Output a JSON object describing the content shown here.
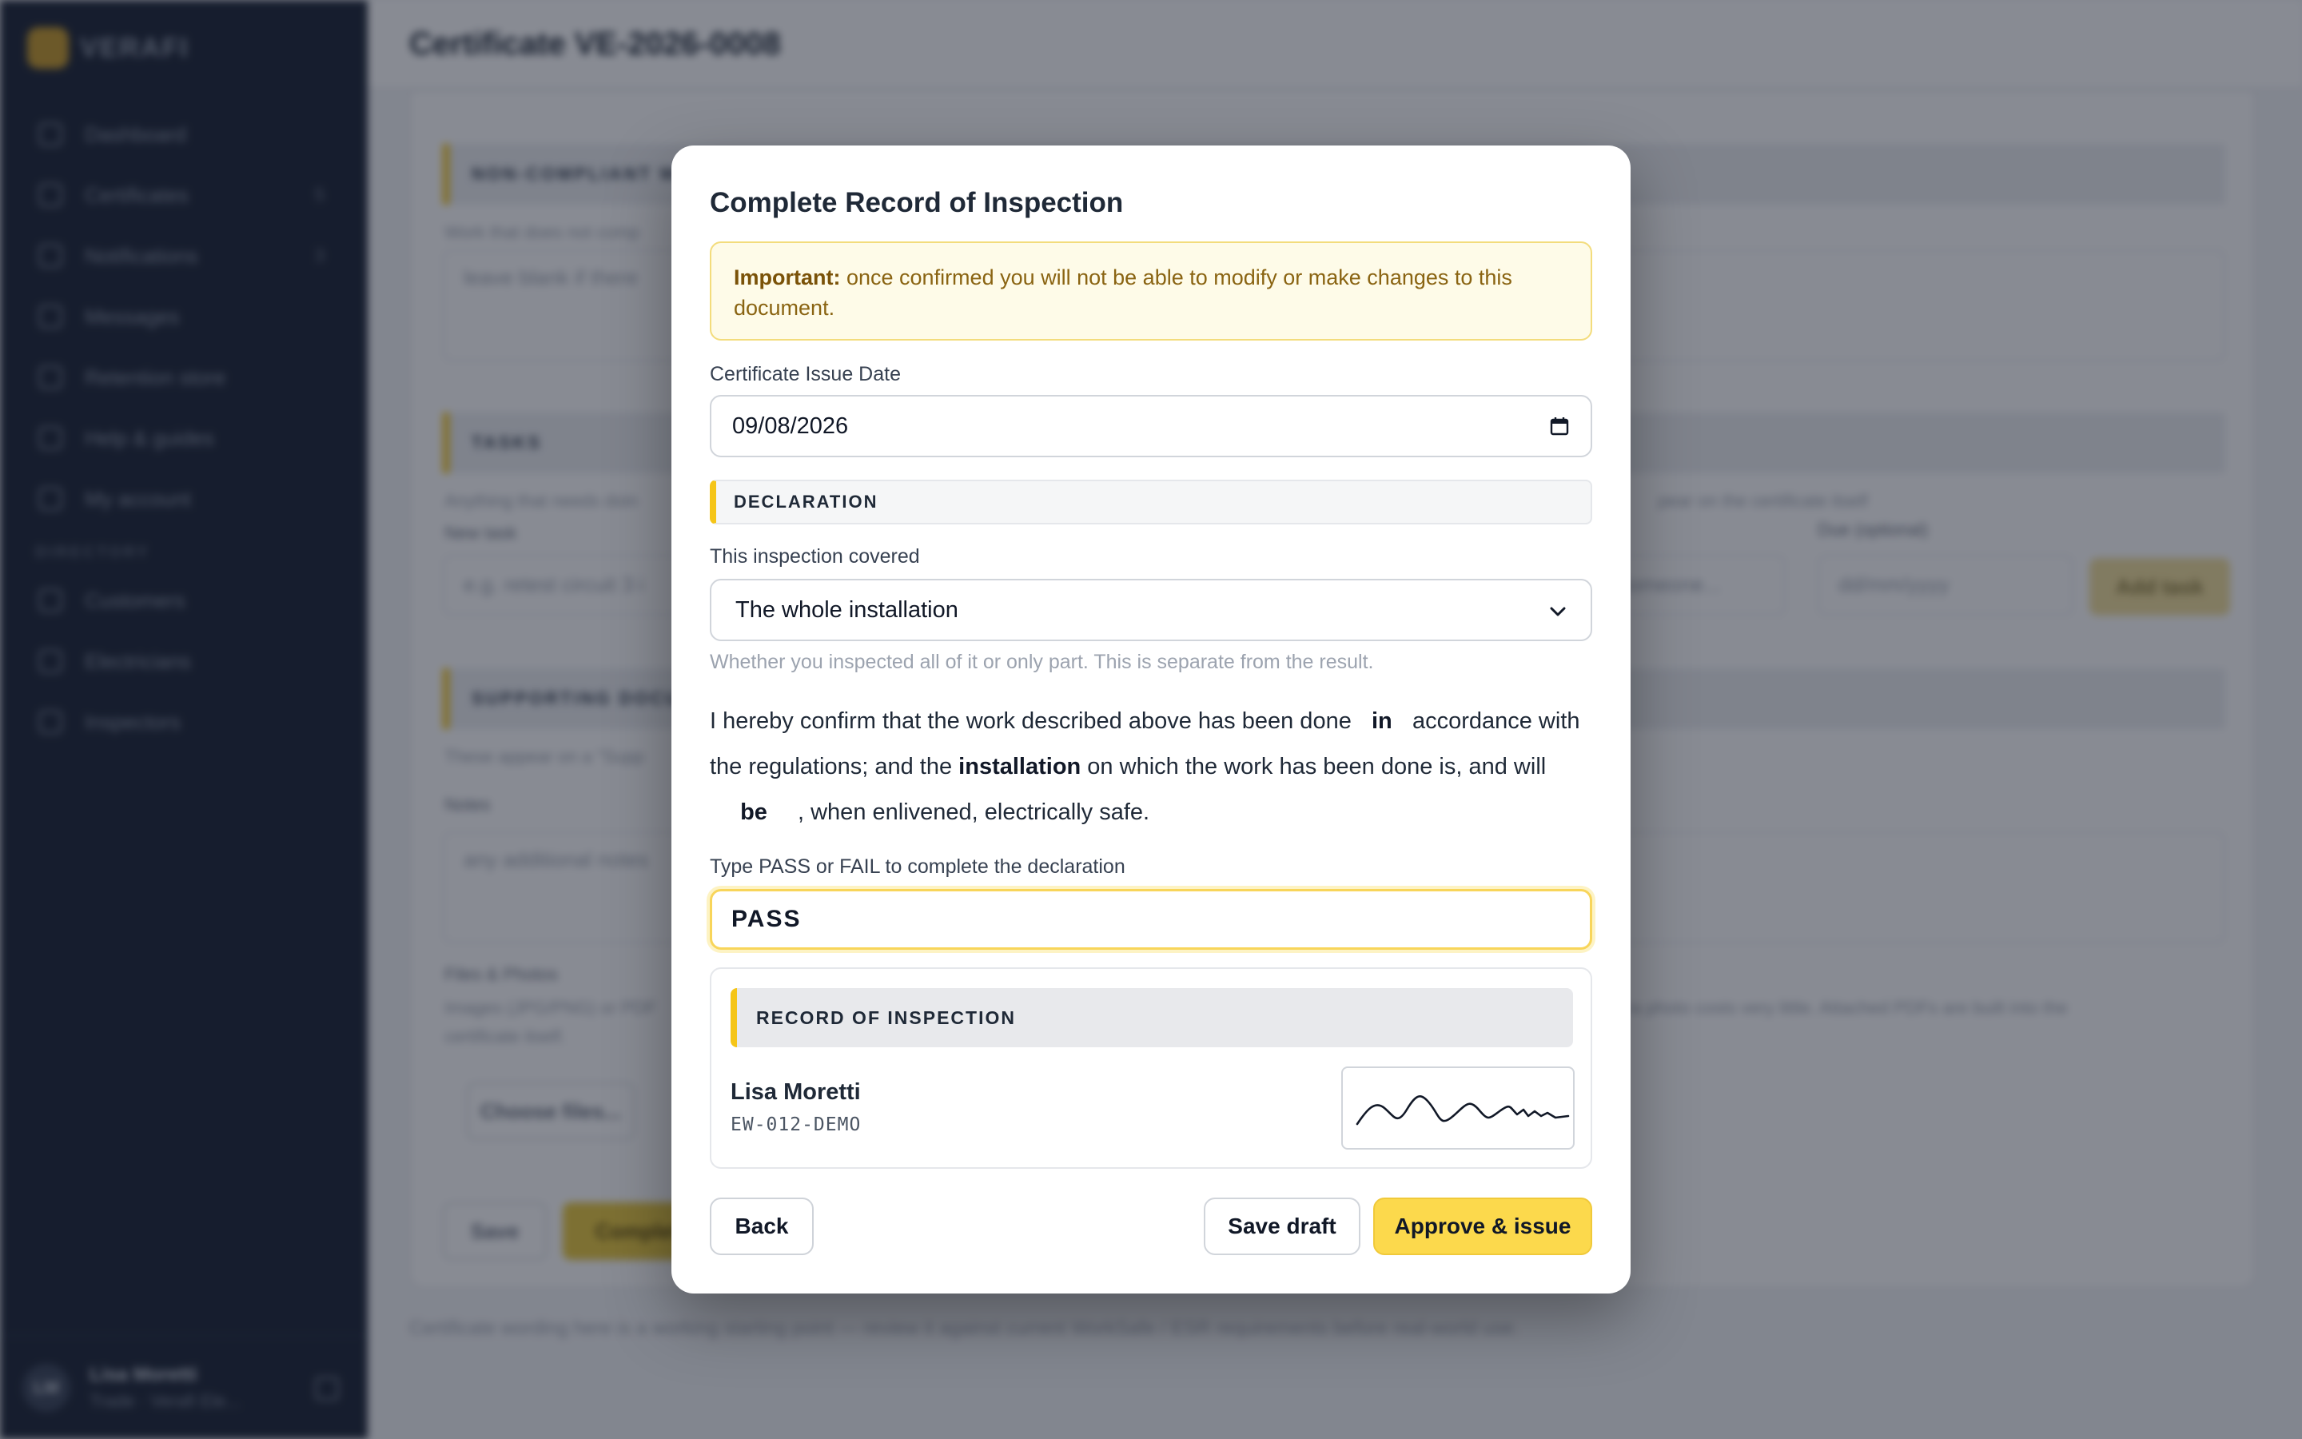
{
  "app": {
    "brand": "VERAFI",
    "page_title": "Certificate VE-2026-0008",
    "nav": [
      {
        "label": "Dashboard",
        "count": ""
      },
      {
        "label": "Certificates",
        "count": "5"
      },
      {
        "label": "Notifications",
        "count": "3"
      },
      {
        "label": "Messages",
        "count": ""
      },
      {
        "label": "Retention store",
        "count": ""
      },
      {
        "label": "Help & guides",
        "count": ""
      },
      {
        "label": "My account",
        "count": ""
      }
    ],
    "directory_label": "DIRECTORY",
    "directory": [
      {
        "label": "Customers"
      },
      {
        "label": "Electricians"
      },
      {
        "label": "Inspectors"
      }
    ],
    "user": {
      "initials": "LM",
      "name": "Lisa Moretti",
      "role": "Trade · Verafi Ele..."
    },
    "sections": {
      "non_compliant": "NON-COMPLIANT W",
      "non_compliant_hint": "Work that does not comp",
      "non_compliant_placeholder": "leave blank if there",
      "tasks": "TASKS",
      "tasks_hint": "Anything that needs doin",
      "tasks_hint_end": "pear on the certificate itself",
      "new_task_label": "New task",
      "new_task_placeholder": "e.g. retest circuit 3 i",
      "assign_placeholder": "Someone...",
      "due_label": "Due (optional)",
      "due_placeholder": "dd/mm/yyyy",
      "add_task": "Add task",
      "supporting": "SUPPORTING DOCU",
      "supporting_hint": "These appear on a \"Supp",
      "notes_label": "Notes",
      "notes_placeholder": "any additional notes",
      "files_label": "Files & Photos",
      "files_hint": "Images (JPG/PNG) or PDF",
      "files_hint_line2": "certificate itself.",
      "files_hint_end": "ra photo costs very little. Attached PDFs are built into the",
      "choose_files": "Choose files...",
      "save": "Save",
      "complete": "Complete"
    },
    "footnote": "Certificate wording here is a working starting point — review it against current WorkSafe / ESR requirements before real-world use."
  },
  "modal": {
    "title": "Complete Record of Inspection",
    "notice_strong": "Important:",
    "notice_text": " once confirmed you will not be able to modify or make changes to this document.",
    "issue_date_label": "Certificate Issue Date",
    "issue_date_value": "09/08/2026",
    "declaration_heading": "DECLARATION",
    "covered_label": "This inspection covered",
    "covered_value": "The whole installation",
    "covered_hint": "Whether you inspected all of it or only part. This is separate from the result.",
    "decl_part1": "I hereby confirm that the work described above has been done ",
    "decl_blank1": "in",
    "decl_part2": " accordance with the regulations; and the ",
    "decl_strong": "installation",
    "decl_part3": " on which the work has been done is, and will ",
    "decl_blank2": "be",
    "decl_part4": ", when enlivened, electrically safe.",
    "pass_label": "Type PASS or FAIL to complete the declaration",
    "pass_value": "PASS",
    "roi_heading": "RECORD OF INSPECTION",
    "inspector_name": "Lisa Moretti",
    "inspector_code": "EW-012-DEMO",
    "back": "Back",
    "save_draft": "Save draft",
    "approve": "Approve & issue"
  },
  "colors": {
    "accent": "#fcd94c",
    "sidebar": "#1b2334",
    "notice_bg": "#fefbe8",
    "notice_text": "#8a6412"
  },
  "icons": {
    "date": "calendar-icon",
    "select": "chevron-down-icon",
    "signature": "signature-image"
  }
}
